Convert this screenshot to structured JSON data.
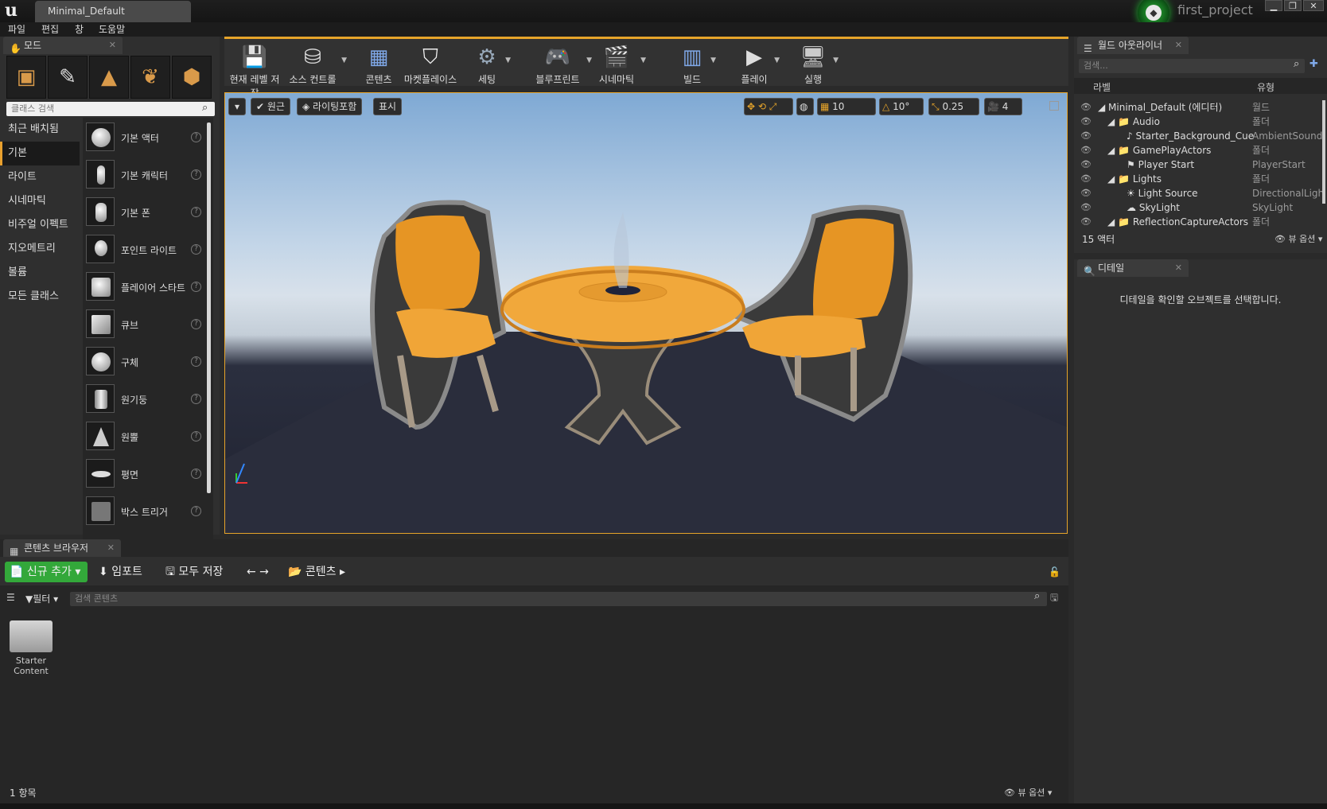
{
  "titlebar": {
    "tab": "Minimal_Default",
    "project": "first_project",
    "min": "▁",
    "max": "❐",
    "close": "✕"
  },
  "menu": [
    "파일",
    "편집",
    "창",
    "도움말"
  ],
  "modes": {
    "tab": "모드",
    "search_placeholder": "클래스 검색",
    "categories": [
      "최근 배치됨",
      "기본",
      "라이트",
      "시네마틱",
      "비주얼 이펙트",
      "지오메트리",
      "볼륨",
      "모든 클래스"
    ],
    "selected_category": "기본",
    "items": [
      "기본 액터",
      "기본 캐릭터",
      "기본 폰",
      "포인트 라이트",
      "플레이어 스타트",
      "큐브",
      "구체",
      "원기둥",
      "원뿔",
      "평면",
      "박스 트리거"
    ]
  },
  "toolbar": [
    {
      "label": "현재 레벨 저장",
      "icon": "save-icon"
    },
    {
      "label": "소스 컨트롤",
      "icon": "source-control-icon"
    },
    {
      "label": "콘텐츠",
      "icon": "content-icon"
    },
    {
      "label": "마켓플레이스",
      "icon": "marketplace-icon"
    },
    {
      "label": "세팅",
      "icon": "settings-icon"
    },
    {
      "label": "블루프린트",
      "icon": "blueprint-icon"
    },
    {
      "label": "시네마틱",
      "icon": "cinematic-icon"
    },
    {
      "label": "빌드",
      "icon": "build-icon"
    },
    {
      "label": "플레이",
      "icon": "play-icon"
    },
    {
      "label": "실행",
      "icon": "launch-icon"
    }
  ],
  "viewport": {
    "perspective": "원근",
    "lit": "라이팅포함",
    "show": "표시",
    "grid_snap": "10",
    "rot_snap": "10°",
    "scale_snap": "0.25",
    "cam_speed": "4"
  },
  "outliner": {
    "tab": "월드 아웃라이너",
    "search_placeholder": "검색...",
    "col_label": "라벨",
    "col_type": "유형",
    "rows": [
      {
        "name": "Minimal_Default (에디터)",
        "type": "월드",
        "indent": 0
      },
      {
        "name": "Audio",
        "type": "폴더",
        "indent": 1
      },
      {
        "name": "Starter_Background_Cue",
        "type": "AmbientSound",
        "indent": 2
      },
      {
        "name": "GamePlayActors",
        "type": "폴더",
        "indent": 1
      },
      {
        "name": "Player Start",
        "type": "PlayerStart",
        "indent": 2
      },
      {
        "name": "Lights",
        "type": "폴더",
        "indent": 1
      },
      {
        "name": "Light Source",
        "type": "DirectionalLigh",
        "indent": 2
      },
      {
        "name": "SkyLight",
        "type": "SkyLight",
        "indent": 2
      },
      {
        "name": "ReflectionCaptureActors",
        "type": "폴더",
        "indent": 1
      }
    ],
    "count": "15 액터",
    "view_options": "뷰 옵션"
  },
  "details": {
    "tab": "디테일",
    "empty": "디테일을 확인할 오브젝트를 선택합니다."
  },
  "content_browser": {
    "tab": "콘텐츠 브라우저",
    "add_new": "신규 추가",
    "import": "임포트",
    "save_all": "모두 저장",
    "path": "콘텐츠",
    "filters": "필터",
    "search_placeholder": "검색 콘텐츠",
    "folder": "Starter\nContent",
    "count": "1 항목",
    "view_options": "뷰 옵션"
  }
}
